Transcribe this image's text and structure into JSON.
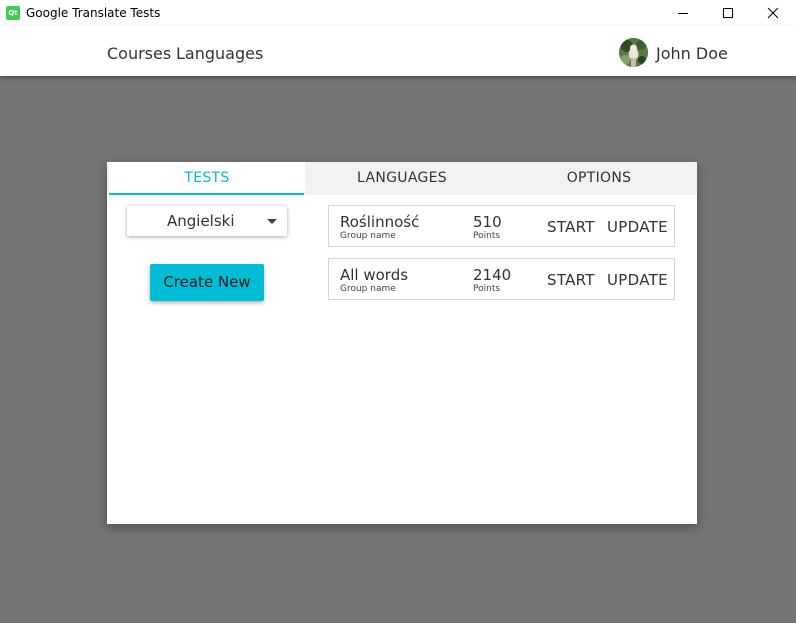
{
  "window": {
    "title": "Google Translate Tests",
    "icon_text": "Qt",
    "controls": [
      "minimize-icon",
      "maximize-icon",
      "close-icon"
    ]
  },
  "appbar": {
    "nav": [
      {
        "label": "Courses"
      },
      {
        "label": "Languages"
      }
    ],
    "user": {
      "name": "John Doe"
    }
  },
  "card": {
    "tabs": [
      {
        "label": "TESTS",
        "active": true
      },
      {
        "label": "LANGUAGES",
        "active": false
      },
      {
        "label": "OPTIONS",
        "active": false
      }
    ],
    "language_select": {
      "value": "Angielski"
    },
    "create_button": {
      "label": "Create New"
    },
    "groups": [
      {
        "name": "Roślinność",
        "name_caption": "Group name",
        "points": "510",
        "points_caption": "Points",
        "start_label": "START",
        "update_label": "UPDATE"
      },
      {
        "name": "All words",
        "name_caption": "Group name",
        "points": "2140",
        "points_caption": "Points",
        "start_label": "START",
        "update_label": "UPDATE"
      }
    ]
  },
  "colors": {
    "accent": "#00bcd4",
    "background": "#757575",
    "surface": "#ffffff",
    "tabbar": "#f2f2f2"
  }
}
